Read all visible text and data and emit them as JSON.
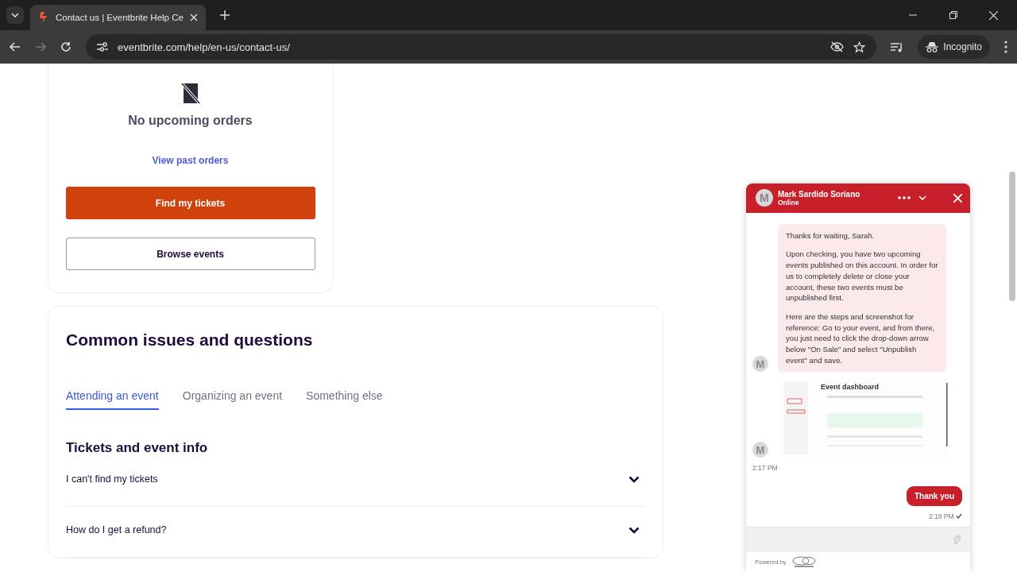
{
  "browser": {
    "tab_title": "Contact us | Eventbrite Help Ce",
    "url": "eventbrite.com/help/en-us/contact-us/",
    "profile": "Incognito"
  },
  "orders_card": {
    "empty_text": "No upcoming orders",
    "link": "View past orders",
    "primary_button": "Find my tickets",
    "secondary_button": "Browse events"
  },
  "issues": {
    "title": "Common issues and questions",
    "tabs": [
      {
        "label": "Attending an event",
        "selected": true
      },
      {
        "label": "Organizing an event",
        "selected": false
      },
      {
        "label": "Something else",
        "selected": false
      }
    ],
    "section_title": "Tickets and event info",
    "questions": [
      {
        "text": "I can't find my tickets",
        "expanded": false
      },
      {
        "text": "How do I get a refund?",
        "expanded": false
      }
    ]
  },
  "chat": {
    "agent_name": "Mark Sardido Soriano",
    "status": "Online",
    "avatar_letter": "M",
    "messages": [
      {
        "kind": "agent_text",
        "avatar": "M",
        "paragraphs": [
          "Thanks for waiting, Sarah.",
          "Upon checking, you have two upcoming events published on this account. In order for us to completely delete or close your account, these two events must be unpublished first.",
          "Here are the steps and screenshot for reference: Go to your event, and from there, you just need to click the drop-down arrow below \"On Sale\"  and select \"Unpublish event\" and save."
        ]
      },
      {
        "kind": "agent_image",
        "avatar": "M",
        "image_title": "Event dashboard",
        "time": "2:17 PM"
      },
      {
        "kind": "user_text",
        "text": "Thank you",
        "time": "2:18 PM"
      }
    ],
    "powered_by": "Powered by"
  }
}
